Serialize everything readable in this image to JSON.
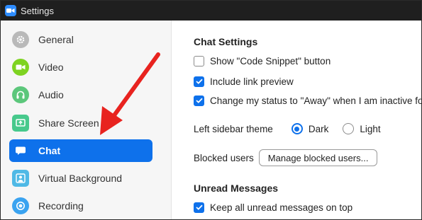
{
  "window": {
    "title": "Settings",
    "app_icon": "zoom-camera-icon"
  },
  "sidebar": {
    "items": [
      {
        "label": "General",
        "icon": "gear-icon",
        "color": "#b9b9b9",
        "active": false
      },
      {
        "label": "Video",
        "icon": "video-camera-icon",
        "color": "#7ed321",
        "active": false
      },
      {
        "label": "Audio",
        "icon": "headphones-icon",
        "color": "#5cc77b",
        "active": false
      },
      {
        "label": "Share Screen",
        "icon": "share-screen-icon",
        "color": "#47c98c",
        "active": false
      },
      {
        "label": "Chat",
        "icon": "chat-bubble-icon",
        "color": "#ffffff",
        "active": true
      },
      {
        "label": "Virtual Background",
        "icon": "person-background-icon",
        "color": "#4fb9e6",
        "active": false
      },
      {
        "label": "Recording",
        "icon": "record-icon",
        "color": "#3aa3f0",
        "active": false
      }
    ]
  },
  "content": {
    "chat_settings_title": "Chat Settings",
    "show_code_snippet": {
      "label": "Show \"Code Snippet\" button",
      "checked": false
    },
    "include_link_preview": {
      "label": "Include link preview",
      "checked": true
    },
    "away_status": {
      "label": "Change my status to \"Away\" when I am inactive for",
      "checked": true
    },
    "sidebar_theme": {
      "label": "Left sidebar theme",
      "options": [
        "Dark",
        "Light"
      ],
      "selected": "Dark"
    },
    "blocked_users": {
      "label": "Blocked users",
      "button": "Manage blocked users..."
    },
    "unread_title": "Unread Messages",
    "keep_unread": {
      "label": "Keep all unread messages on top",
      "checked": true
    }
  },
  "annotation": {
    "arrow_color": "#e8231f"
  },
  "colors": {
    "accent": "#0e71eb",
    "titlebar": "#1f1f1f",
    "sidebar_bg": "#f6f6f6"
  }
}
